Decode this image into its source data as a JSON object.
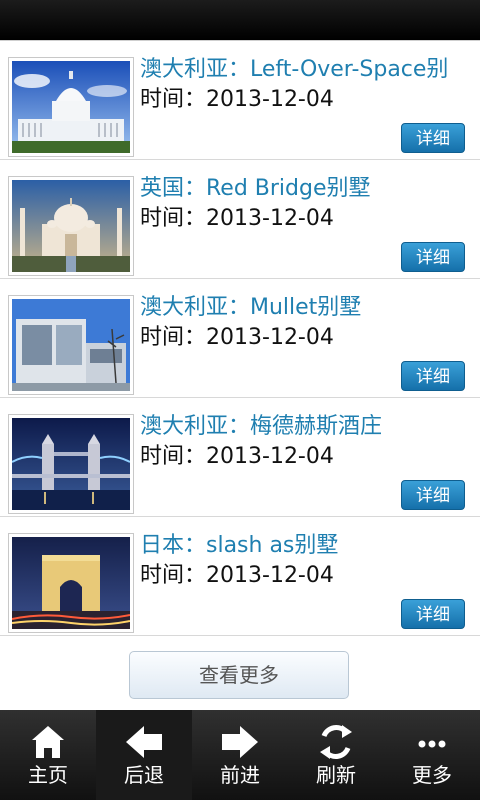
{
  "app": {
    "window_title": ""
  },
  "items": [
    {
      "title": "澳大利亚：Left-Over-Space别",
      "time_label": "时间：",
      "date": "2013-12-04",
      "detail_label": "详细",
      "thumb": "capitol-building"
    },
    {
      "title": "英国：Red Bridge别墅",
      "time_label": "时间：",
      "date": "2013-12-04",
      "detail_label": "详细",
      "thumb": "taj-mahal"
    },
    {
      "title": "澳大利亚：Mullet别墅",
      "time_label": "时间：",
      "date": "2013-12-04",
      "detail_label": "详细",
      "thumb": "modern-glass-building"
    },
    {
      "title": "澳大利亚：梅德赫斯酒庄",
      "time_label": "时间：",
      "date": "2013-12-04",
      "detail_label": "详细",
      "thumb": "tower-bridge-night"
    },
    {
      "title": "日本：slash as别墅",
      "time_label": "时间：",
      "date": "2013-12-04",
      "detail_label": "详细",
      "thumb": "arc-de-triomphe-night"
    }
  ],
  "more_button": {
    "label": "查看更多"
  },
  "tabbar": {
    "tabs": [
      {
        "label": "主页",
        "icon": "home-icon"
      },
      {
        "label": "后退",
        "icon": "arrow-left-icon"
      },
      {
        "label": "前进",
        "icon": "arrow-right-icon"
      },
      {
        "label": "刷新",
        "icon": "refresh-icon"
      },
      {
        "label": "更多",
        "icon": "more-dots-icon"
      }
    ]
  }
}
